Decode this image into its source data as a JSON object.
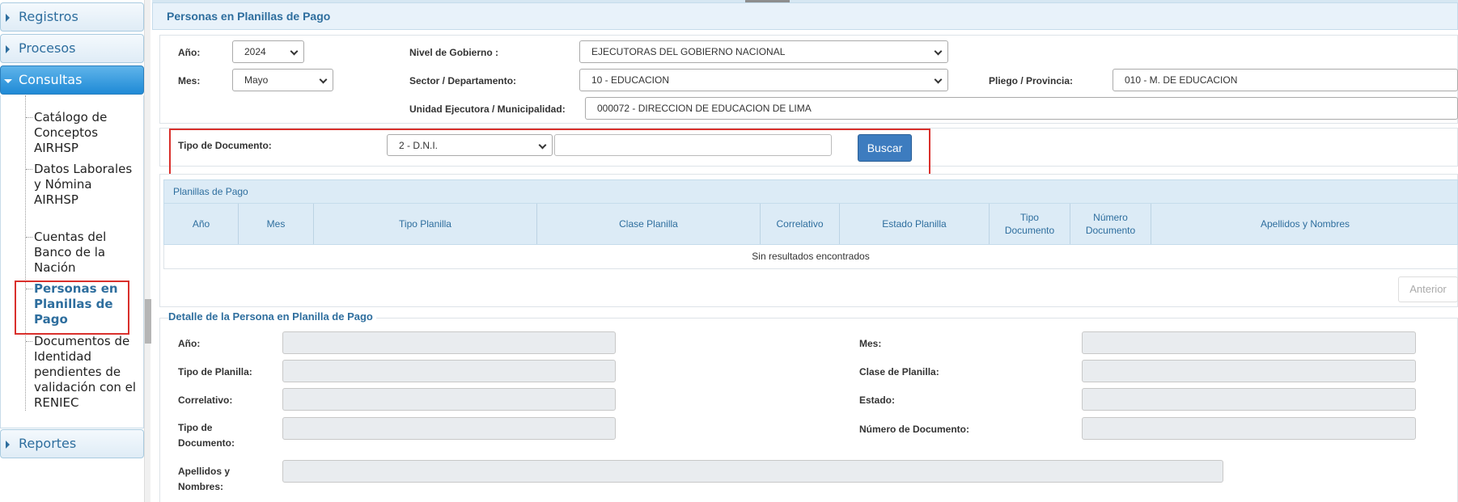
{
  "sidebar": {
    "registros": "Registros",
    "procesos": "Procesos",
    "consultas": "Consultas",
    "reportes": "Reportes",
    "items": [
      "Catálogo de Conceptos AIRHSP",
      "Datos Laborales y Nómina AIRHSP",
      "Cuentas del Banco de la Nación",
      "Personas en Planillas de Pago",
      "Documentos de Identidad pendientes de validación con el RENIEC"
    ]
  },
  "header": {
    "title": "Personas en Planillas de Pago"
  },
  "filters": {
    "anio_label": "Año:",
    "anio_value": "2024",
    "mes_label": "Mes:",
    "mes_value": "Mayo",
    "nivel_label": "Nivel de Gobierno :",
    "nivel_value": "EJECUTORAS DEL GOBIERNO NACIONAL",
    "sector_label": "Sector / Departamento:",
    "sector_value": "10 - EDUCACION",
    "pliego_label": "Pliego / Provincia:",
    "pliego_value": "010 - M. DE EDUCACION",
    "unidad_label": "Unidad Ejecutora / Municipalidad:",
    "unidad_value": "000072 - DIRECCION DE EDUCACION DE LIMA"
  },
  "search": {
    "tipo_doc_label": "Tipo de Documento:",
    "tipo_doc_value": "2 - D.N.I.",
    "doc_input_value": "",
    "buscar_label": "Buscar"
  },
  "table": {
    "title": "Planillas de Pago",
    "columns": [
      "Año",
      "Mes",
      "Tipo Planilla",
      "Clase Planilla",
      "Correlativo",
      "Estado Planilla",
      "Tipo Documento",
      "Número Documento",
      "Apellidos y Nombres"
    ],
    "empty_text": "Sin resultados encontrados",
    "anterior_label": "Anterior"
  },
  "detail": {
    "legend": "Detalle de la Persona en Planilla de Pago",
    "anio_label": "Año:",
    "mes_label": "Mes:",
    "tipo_planilla_label": "Tipo de Planilla:",
    "clase_planilla_label": "Clase de Planilla:",
    "correlativo_label": "Correlativo:",
    "estado_label": "Estado:",
    "tipo_doc_label_1": "Tipo de",
    "tipo_doc_label_2": "Documento:",
    "numero_doc_label": "Número de Documento:",
    "apellidos_label_1": "Apellidos y",
    "apellidos_label_2": "Nombres:"
  },
  "colors": {
    "accent": "#2e6e9e",
    "button": "#3d7cbf",
    "highlight": "#d9302c"
  }
}
